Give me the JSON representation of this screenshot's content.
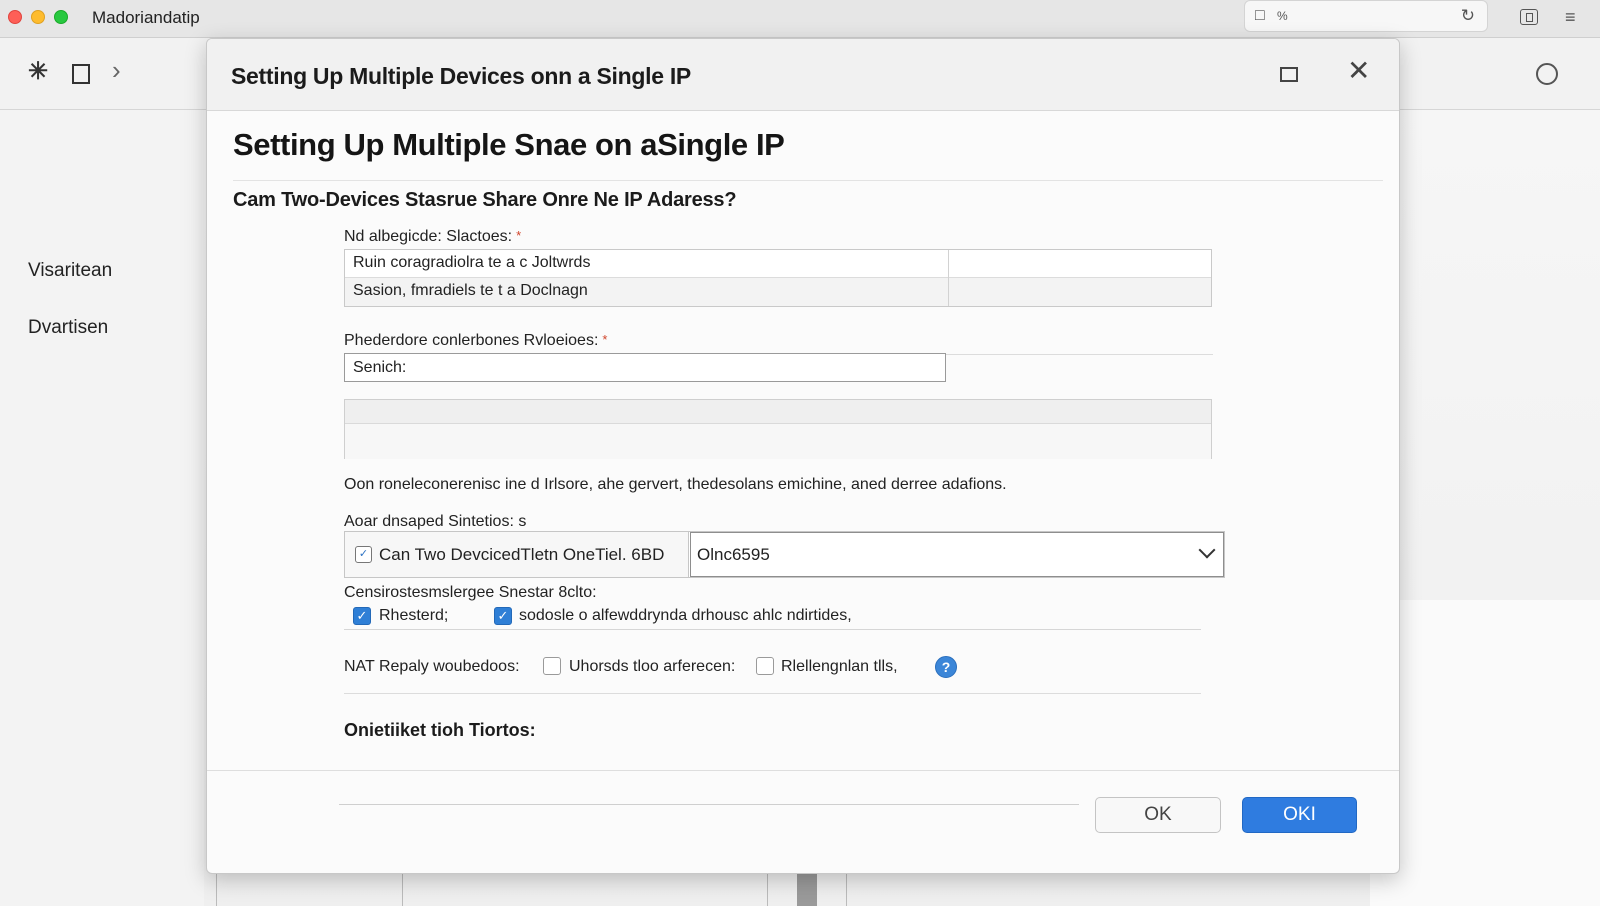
{
  "window": {
    "app_title": "Madoriandatip",
    "address_icons": [
      "clipboard-icon",
      "percent-icon",
      "refresh-icon"
    ],
    "address_glyph": "%"
  },
  "sidebar": {
    "items": [
      {
        "label": "Visaritean"
      },
      {
        "label": "Dvartisen"
      }
    ]
  },
  "dialog": {
    "title": "Setting Up Multiple Devices onn a Single IP",
    "heading": "Setting Up Multiple Snae on aSingle IP",
    "subheading": "Cam Two-Devices Stasrue Share Onre Ne IP Adaress?",
    "table1_label": "Nd albegicde: Slactoes:",
    "table1_rows": [
      {
        "left": "Ruin coragradiolra te a c Joltwrds",
        "right": ""
      },
      {
        "left": "Sasion, fmradiels te t a Doclnagn",
        "right": ""
      }
    ],
    "search_label": "Phederdore conlerbones Rvloeioes:",
    "search_value": "Senich:",
    "description": "Oon roneleconerenisc ine d Irlsore, ahe gervert, thedesolans emichine, aned derree adafions.",
    "shared_label": "Aoar dnsaped Sintetios: s",
    "combo_left": "Can Two DevcicedTletn OneTiel. 6BD",
    "combo_value": "Olnc6595",
    "options_label": "Censirostesmslergee Snestar 8clto:",
    "options": [
      {
        "label": "Rhesterd;",
        "checked": true
      },
      {
        "label": "sodosle o alfewddrynda drhousc ahlc ndirtides,",
        "checked": true
      }
    ],
    "nat_label": "NAT Repaly woubedoos:",
    "nat_options": [
      {
        "label": "Uhorsds tloo arferecen:",
        "checked": false
      },
      {
        "label": "Rlellengnlan tlls,",
        "checked": false
      }
    ],
    "help_glyph": "?",
    "section3": "Onietiiket tioh Tiortos:",
    "buttons": {
      "ok": "OK",
      "ok2": "OKI"
    }
  },
  "colors": {
    "primary_button": "#2f7ce0",
    "checkbox_on": "#2f7fd6",
    "required_star": "#d0442a"
  }
}
